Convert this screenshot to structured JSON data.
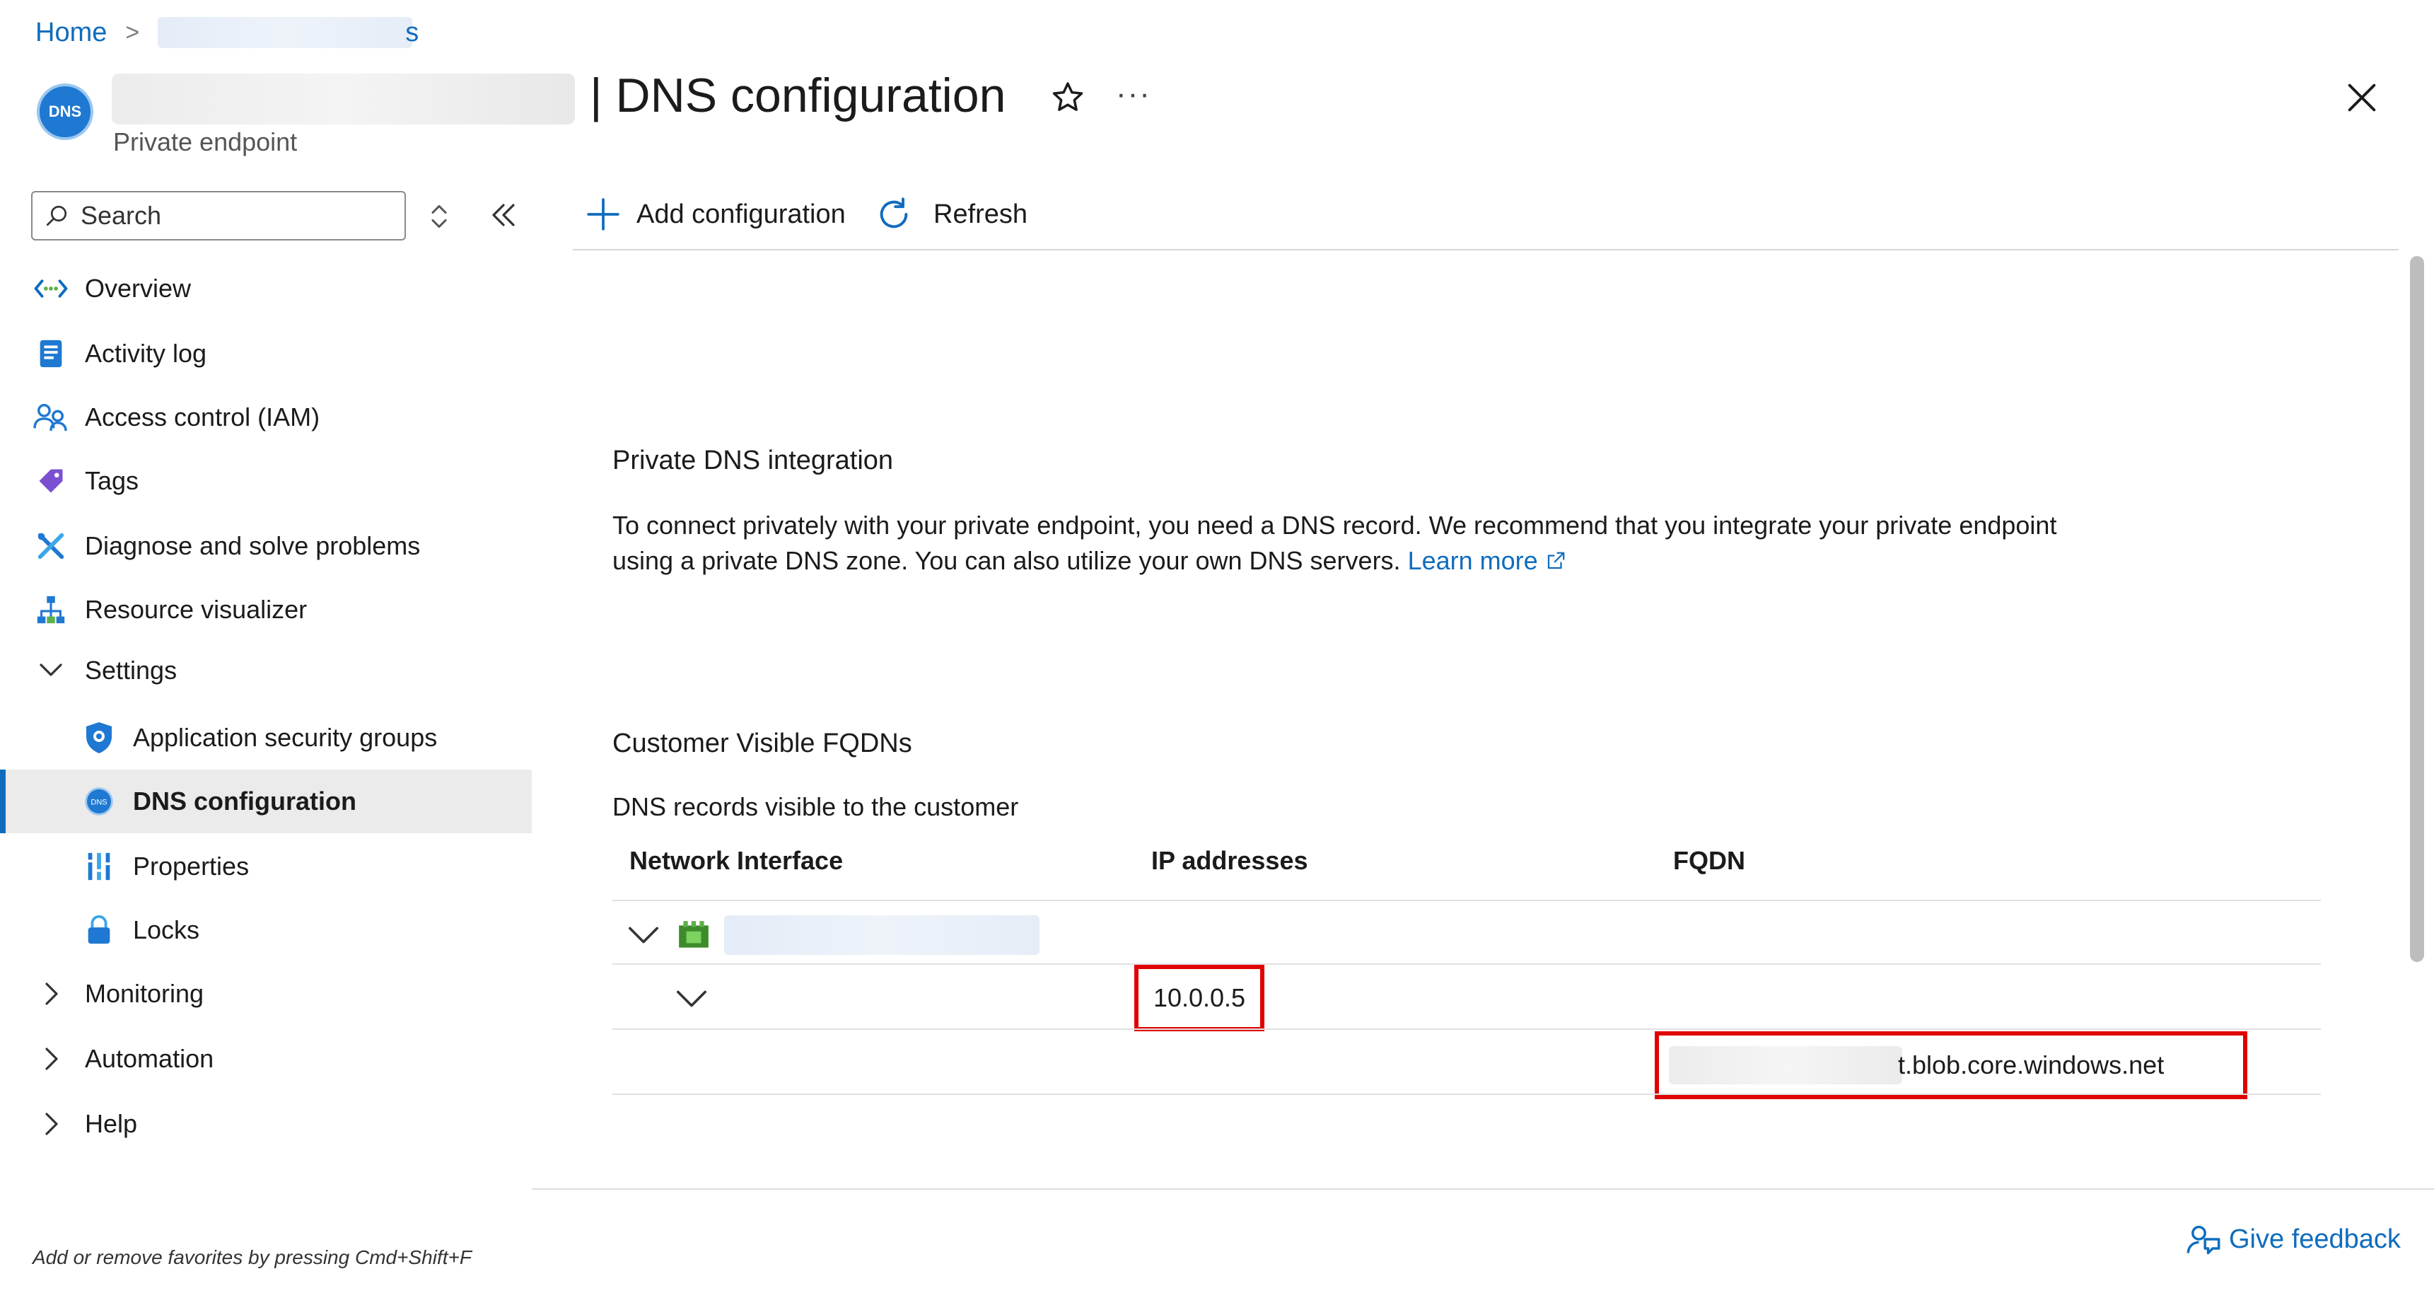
{
  "breadcrumb": {
    "home": "Home",
    "separator": ">",
    "current_tail": "s"
  },
  "header": {
    "resource_icon_text": "DNS",
    "title": "| DNS configuration",
    "subtitle": "Private endpoint",
    "more": "···"
  },
  "sidebar": {
    "search_placeholder": "Search",
    "items": [
      {
        "label": "Overview",
        "icon": "overview-icon"
      },
      {
        "label": "Activity log",
        "icon": "activity-log-icon"
      },
      {
        "label": "Access control (IAM)",
        "icon": "iam-icon"
      },
      {
        "label": "Tags",
        "icon": "tag-icon"
      },
      {
        "label": "Diagnose and solve problems",
        "icon": "wrench-icon"
      },
      {
        "label": "Resource visualizer",
        "icon": "visualizer-icon"
      },
      {
        "label": "Settings",
        "icon": "chevron-down-icon"
      },
      {
        "label": "Application security groups",
        "icon": "shield-icon"
      },
      {
        "label": "DNS configuration",
        "icon": "dns-icon"
      },
      {
        "label": "Properties",
        "icon": "properties-icon"
      },
      {
        "label": "Locks",
        "icon": "lock-icon"
      },
      {
        "label": "Monitoring",
        "icon": "chevron-right-icon"
      },
      {
        "label": "Automation",
        "icon": "chevron-right-icon"
      },
      {
        "label": "Help",
        "icon": "chevron-right-icon"
      }
    ],
    "favorites_hint": "Add or remove favorites by pressing Cmd+Shift+F"
  },
  "toolbar": {
    "add_label": "Add configuration",
    "refresh_label": "Refresh"
  },
  "main": {
    "integration_title": "Private DNS integration",
    "integration_text": "To connect privately with your private endpoint, you need a DNS record. We recommend that you integrate your private endpoint using a private DNS zone. You can also utilize your own DNS servers.",
    "learn_more": "Learn more",
    "fqdn_title": "Customer Visible FQDNs",
    "fqdn_subtext": "DNS records visible to the customer",
    "table": {
      "headers": [
        "Network Interface",
        "IP addresses",
        "FQDN"
      ],
      "ip": "10.0.0.5",
      "fqdn_tail": "t.blob.core.windows.net"
    }
  },
  "feedback": "Give feedback",
  "colors": {
    "accent": "#0f6cbd",
    "highlight": "#e00000"
  }
}
